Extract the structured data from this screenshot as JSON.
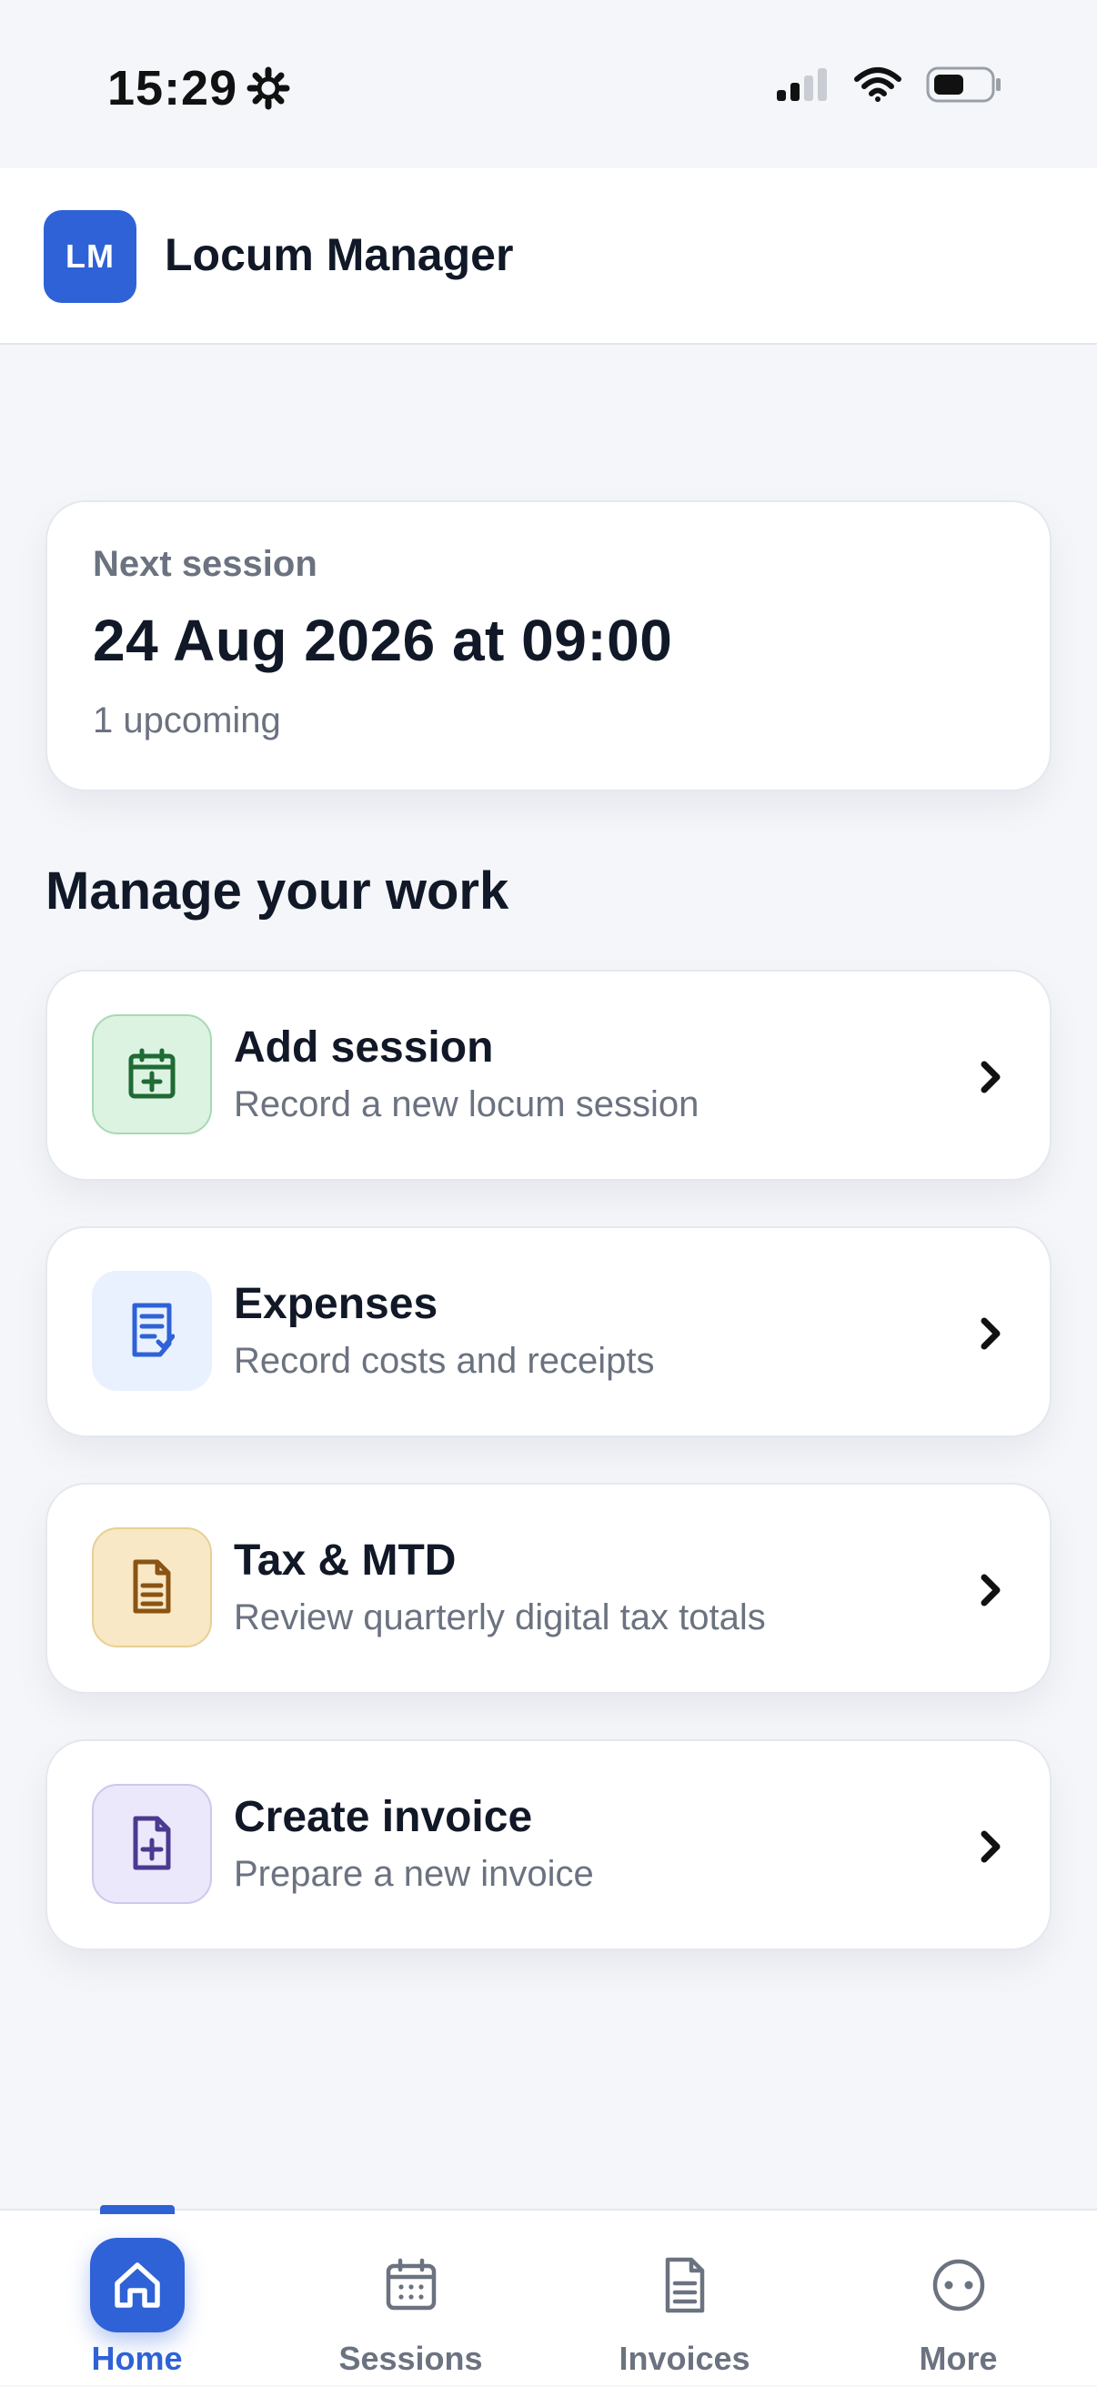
{
  "status_bar": {
    "time": "15:29"
  },
  "header": {
    "logo_initials": "LM",
    "title": "Locum Manager"
  },
  "next_session": {
    "label": "Next session",
    "datetime": "24 Aug 2026 at 09:00",
    "count_text": "1 upcoming"
  },
  "manage": {
    "title": "Manage your work",
    "actions": [
      {
        "title": "Add session",
        "subtitle": "Record a new locum session",
        "icon": "calendar-plus-icon",
        "tint_bg": "#dcf3e1",
        "tint_border": "#a7d9b3",
        "tint_fg": "#1f6a35"
      },
      {
        "title": "Expenses",
        "subtitle": "Record costs and receipts",
        "icon": "receipt-icon",
        "tint_bg": "#e9f1ff",
        "tint_border": "#e9f1ff",
        "tint_fg": "#2f62d6"
      },
      {
        "title": "Tax & MTD",
        "subtitle": "Review quarterly digital tax totals",
        "icon": "document-icon",
        "tint_bg": "#f8e8c6",
        "tint_border": "#e8cf94",
        "tint_fg": "#8a5414"
      },
      {
        "title": "Create invoice",
        "subtitle": "Prepare a new invoice",
        "icon": "file-plus-icon",
        "tint_bg": "#ece8fb",
        "tint_border": "#cfc6ee",
        "tint_fg": "#4b3a8f"
      }
    ]
  },
  "tab_bar": {
    "tabs": [
      {
        "label": "Home",
        "icon": "home-icon",
        "active": true
      },
      {
        "label": "Sessions",
        "icon": "calendar-icon",
        "active": false
      },
      {
        "label": "Invoices",
        "icon": "invoice-icon",
        "active": false
      },
      {
        "label": "More",
        "icon": "more-icon",
        "active": false
      }
    ]
  },
  "colors": {
    "accent": "#2f62d6",
    "background": "#f4f6fa",
    "muted_text": "#6b7280"
  }
}
